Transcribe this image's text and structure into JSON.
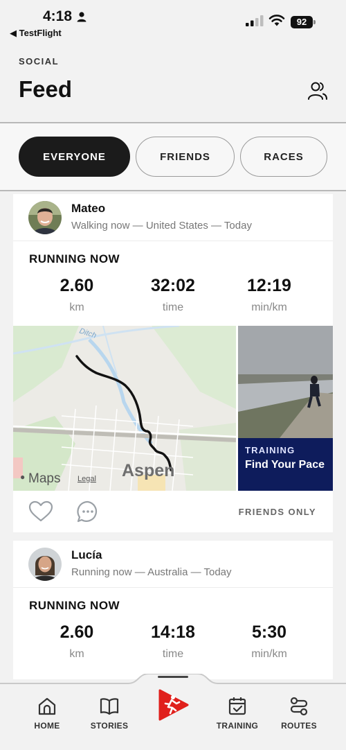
{
  "status_bar": {
    "time": "4:18",
    "back_label": "◀ TestFlight",
    "battery": "92"
  },
  "header": {
    "kicker": "SOCIAL",
    "title": "Feed"
  },
  "filters": [
    {
      "label": "EVERYONE",
      "active": true
    },
    {
      "label": "FRIENDS",
      "active": false
    },
    {
      "label": "RACES",
      "active": false
    }
  ],
  "feed": [
    {
      "name": "Mateo",
      "subtitle": "Walking now — United States — Today",
      "activity_label": "RUNNING NOW",
      "stats": [
        {
          "value": "2.60",
          "unit": "km"
        },
        {
          "value": "32:02",
          "unit": "time"
        },
        {
          "value": "12:19",
          "unit": "min/km"
        }
      ],
      "map": {
        "city": "Aspen",
        "brand": "Maps",
        "legal": "Legal",
        "waterway": "Ditch"
      },
      "promo": {
        "kicker": "TRAINING",
        "title": "Find Your Pace"
      },
      "visibility": "FRIENDS ONLY"
    },
    {
      "name": "Lucía",
      "subtitle": "Running now — Australia — Today",
      "activity_label": "RUNNING NOW",
      "stats": [
        {
          "value": "2.60",
          "unit": "km"
        },
        {
          "value": "14:18",
          "unit": "time"
        },
        {
          "value": "5:30",
          "unit": "min/km"
        }
      ]
    }
  ],
  "tabbar": [
    {
      "label": "HOME",
      "icon": "home-icon"
    },
    {
      "label": "STORIES",
      "icon": "book-icon"
    },
    {
      "label": "",
      "icon": "runner-logo-icon"
    },
    {
      "label": "TRAINING",
      "icon": "calendar-check-icon"
    },
    {
      "label": "ROUTES",
      "icon": "route-icon"
    }
  ],
  "colors": {
    "accent": "#e0201c",
    "promo_bg": "#0e1c5c",
    "pill_active": "#1b1b1b"
  }
}
